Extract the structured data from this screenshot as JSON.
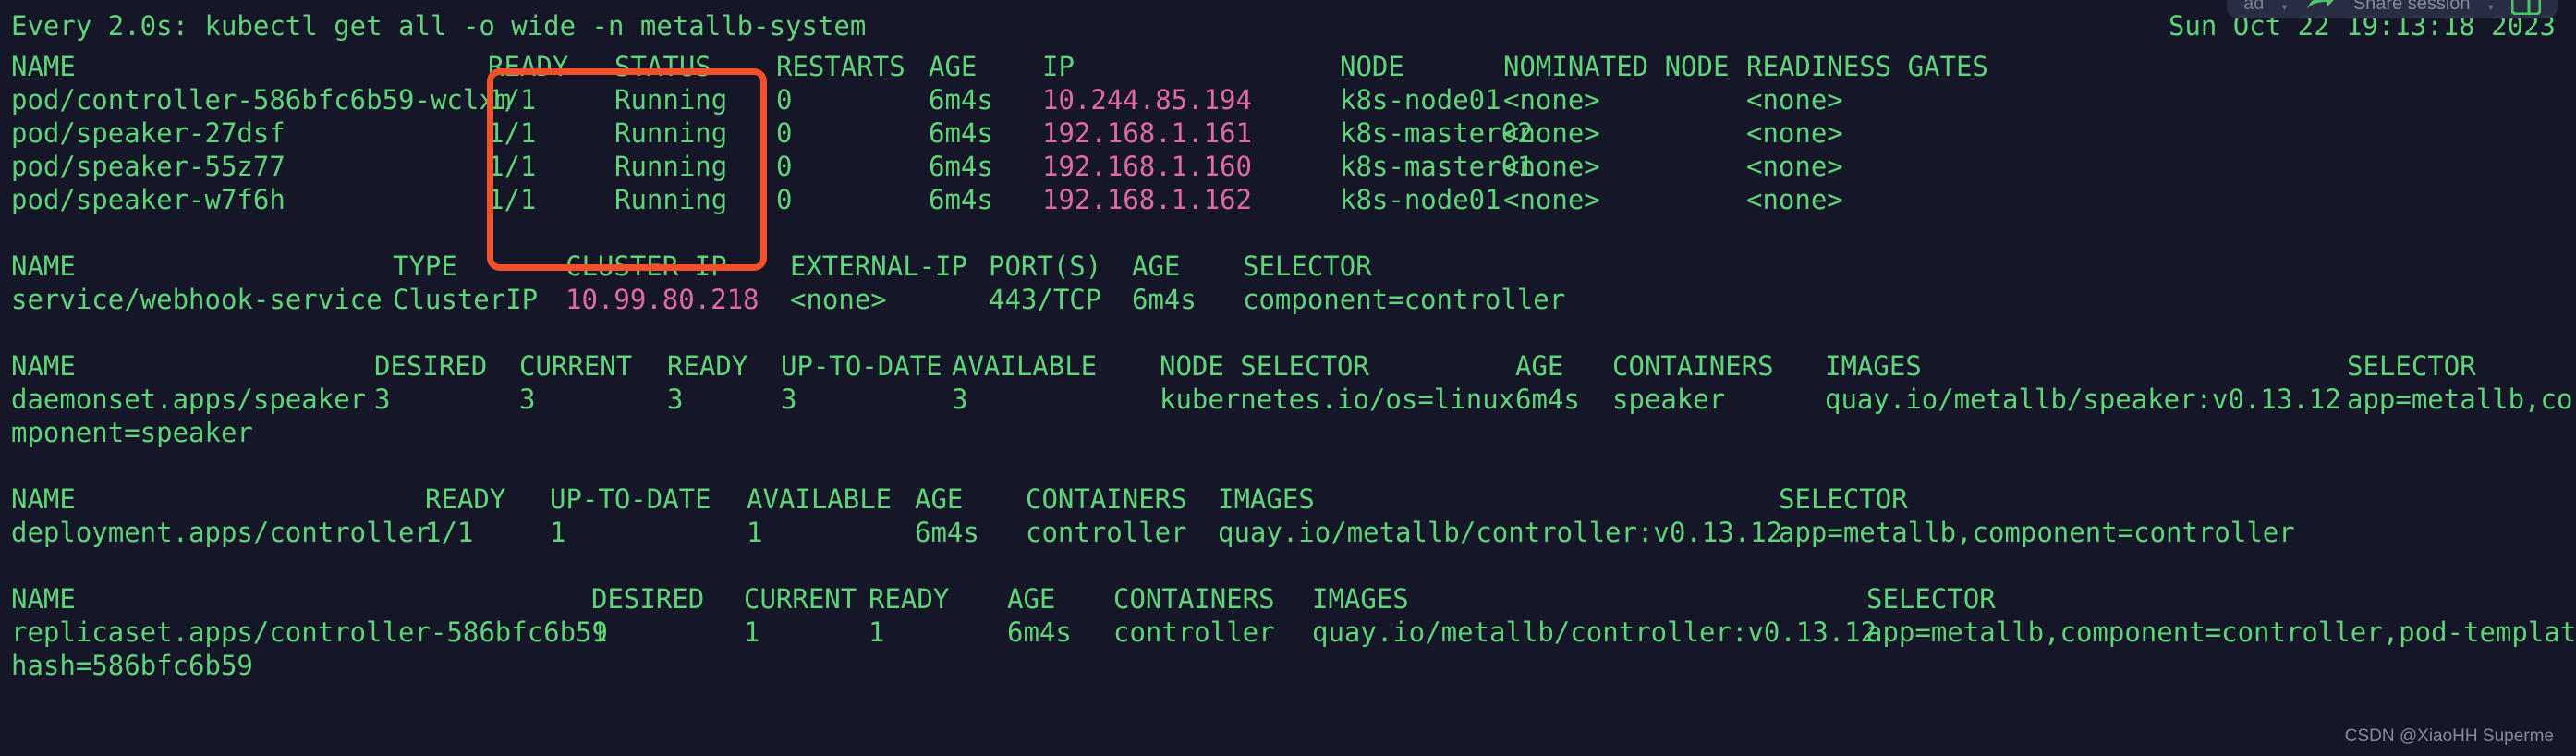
{
  "terminal": {
    "watch_header": "Every 2.0s: kubectl get all -o wide -n metallb-system",
    "datetime": "Sun Oct 22 19:13:18 2023",
    "colors": {
      "background": "#151627",
      "text_green": "#5fd479",
      "ip_pink": "#e06c9f",
      "highlight_red": "#f4502a",
      "watermark": "#9aa0b0"
    },
    "blocks": [
      {
        "id": "pods",
        "header": "NAME                             READY   STATUS    RESTARTS   AGE    IP              NODE           NOMINATED NODE   READINESS GATES",
        "rows": [
          {
            "name": "pod/controller-586bfc6b59-wclxm",
            "ready": "1/1",
            "status": "Running",
            "restarts": "0",
            "age": "6m4s",
            "ip": "10.244.85.194",
            "node": "k8s-node01",
            "nominated_node": "<none>",
            "readiness_gates": "<none>"
          },
          {
            "name": "pod/speaker-27dsf",
            "ready": "1/1",
            "status": "Running",
            "restarts": "0",
            "age": "6m4s",
            "ip": "192.168.1.161",
            "node": "k8s-master02",
            "nominated_node": "<none>",
            "readiness_gates": "<none>"
          },
          {
            "name": "pod/speaker-55z77",
            "ready": "1/1",
            "status": "Running",
            "restarts": "0",
            "age": "6m4s",
            "ip": "192.168.1.160",
            "node": "k8s-master01",
            "nominated_node": "<none>",
            "readiness_gates": "<none>"
          },
          {
            "name": "pod/speaker-w7f6h",
            "ready": "1/1",
            "status": "Running",
            "restarts": "0",
            "age": "6m4s",
            "ip": "192.168.1.162",
            "node": "k8s-node01",
            "nominated_node": "<none>",
            "readiness_gates": "<none>"
          }
        ]
      },
      {
        "id": "services",
        "header": "NAME                     TYPE        CLUSTER-IP     EXTERNAL-IP   PORT(S)   AGE    SELECTOR",
        "rows": [
          {
            "name": "service/webhook-service",
            "type": "ClusterIP",
            "cluster_ip": "10.99.80.218",
            "external_ip": "<none>",
            "ports": "443/TCP",
            "age": "6m4s",
            "selector": "component=controller"
          }
        ]
      },
      {
        "id": "daemonsets",
        "header": "NAME                      DESIRED   CURRENT   READY   UP-TO-DATE   AVAILABLE   NODE SELECTOR            AGE    CONTAINERS   IMAGES                             SELECTOR",
        "rows": [
          {
            "name": "daemonset.apps/speaker",
            "desired": "3",
            "current": "3",
            "ready": "3",
            "up_to_date": "3",
            "available": "3",
            "node_selector": "kubernetes.io/os=linux",
            "age": "6m4s",
            "containers": "speaker",
            "images": "quay.io/metallb/speaker:v0.13.12",
            "selector": "app=metallb,co"
          }
        ],
        "wrap_line": "mponent=speaker"
      },
      {
        "id": "deployments",
        "header": "NAME                          READY   UP-TO-DATE   AVAILABLE   AGE    CONTAINERS   IMAGES                                SELECTOR",
        "rows": [
          {
            "name": "deployment.apps/controller",
            "ready": "1/1",
            "up_to_date": "1",
            "available": "1",
            "age": "6m4s",
            "containers": "controller",
            "images": "quay.io/metallb/controller:v0.13.12",
            "selector": "app=metallb,component=controller"
          }
        ]
      },
      {
        "id": "replicasets",
        "header": "NAME                                      DESIRED   CURRENT   READY   AGE    CONTAINERS   IMAGES                                SELECTOR",
        "rows": [
          {
            "name": "replicaset.apps/controller-586bfc6b59",
            "desired": "1",
            "current": "1",
            "ready": "1",
            "age": "6m4s",
            "containers": "controller",
            "images": "quay.io/metallb/controller:v0.13.12",
            "selector": "app=metallb,component=controller,pod-template-"
          }
        ],
        "wrap_line": "hash=586bfc6b59"
      }
    ],
    "annotation": {
      "type": "rectangle-highlight",
      "color": "#f4502a",
      "covers_columns": "READY STATUS"
    }
  },
  "float_toolbar": {
    "input_value": "ad",
    "share_label": "Share session",
    "share_icon": "share-icon",
    "panel_icon": "panel-layout-icon",
    "caret_icon": "chevron-down-icon"
  },
  "watermark": {
    "text": "CSDN @XiaoHH Superme"
  }
}
